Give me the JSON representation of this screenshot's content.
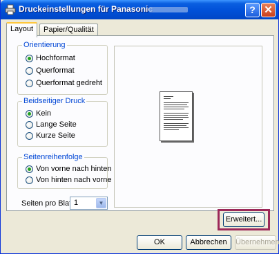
{
  "window": {
    "title": "Druckeinstellungen für Panasonic",
    "help_label": "?",
    "close_label": "✕"
  },
  "tabs": [
    {
      "label": "Layout"
    },
    {
      "label": "Papier/Qualität"
    }
  ],
  "orientation": {
    "legend": "Orientierung",
    "options": [
      "Hochformat",
      "Querformat",
      "Querformat gedreht"
    ],
    "selected": "Hochformat"
  },
  "duplex": {
    "legend": "Beidseitiger Druck",
    "options": [
      "Kein",
      "Lange Seite",
      "Kurze Seite"
    ],
    "selected": "Kein"
  },
  "page_order": {
    "legend": "Seitenreihenfolge",
    "options": [
      "Von vorne nach hinten",
      "Von hinten nach vorne"
    ],
    "selected": "Von vorne nach hinten"
  },
  "pages_per_sheet": {
    "label": "Seiten pro Blatt:",
    "value": "1"
  },
  "buttons": {
    "advanced": "Erweitert...",
    "ok": "OK",
    "cancel": "Abbrechen",
    "apply": "Übernehmen"
  },
  "colors": {
    "titlebar": "#0050d8",
    "group_legend": "#0046d5",
    "highlight": "#9c2859",
    "radio_selected": "#21a121"
  }
}
